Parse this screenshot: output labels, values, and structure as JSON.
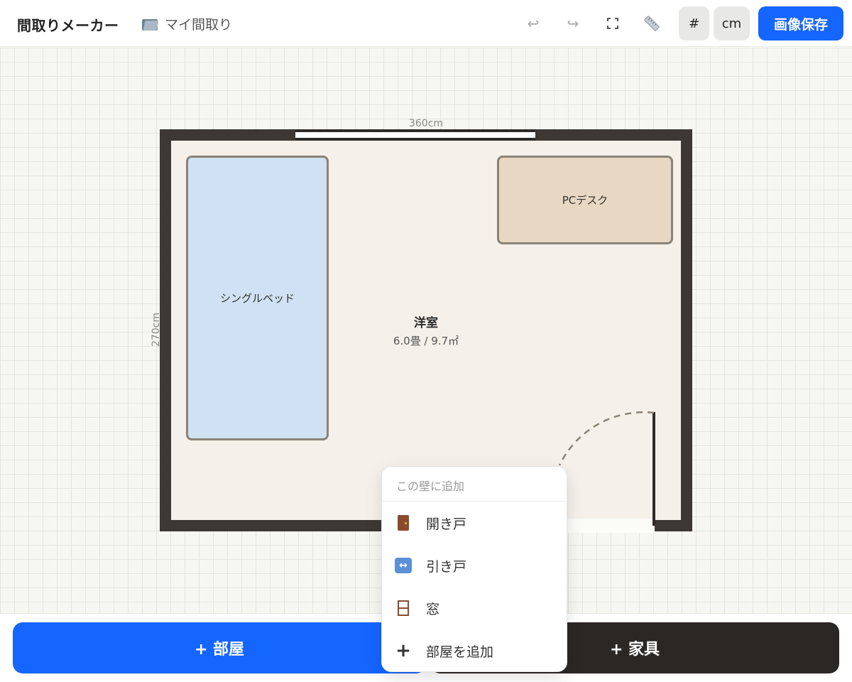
{
  "header": {
    "app_title": "間取りメーカー",
    "folder_name": "マイ間取り",
    "undo_icon": "↩",
    "redo_icon": "↪",
    "fullscreen_icon": "⛶",
    "ruler_icon": "📏",
    "grid_toggle_label": "#",
    "unit_toggle_label": "cm",
    "save_label": "画像保存"
  },
  "floorplan": {
    "width_label": "360cm",
    "height_label": "270cm",
    "room": {
      "name": "洋室",
      "area": "6.0畳 / 9.7㎡"
    },
    "furniture": [
      {
        "label": "シングルベッド"
      },
      {
        "label": "PCデスク"
      }
    ]
  },
  "popup": {
    "title": "この壁に追加",
    "items": [
      {
        "label": "開き戸",
        "icon": "door-icon"
      },
      {
        "label": "引き戸",
        "icon": "left-right-arrow-icon"
      },
      {
        "label": "窓",
        "icon": "window-icon"
      },
      {
        "label": "部屋を追加",
        "icon": "plus-icon"
      }
    ]
  },
  "bottom": {
    "add_room_label": "+ 部屋",
    "add_furniture_label": "+ 家具"
  },
  "colors": {
    "accent": "#1565ff",
    "dark": "#2b2725",
    "wall": "#3d3833",
    "bed": "#cfe1f2",
    "desk": "#e8d8c3"
  }
}
